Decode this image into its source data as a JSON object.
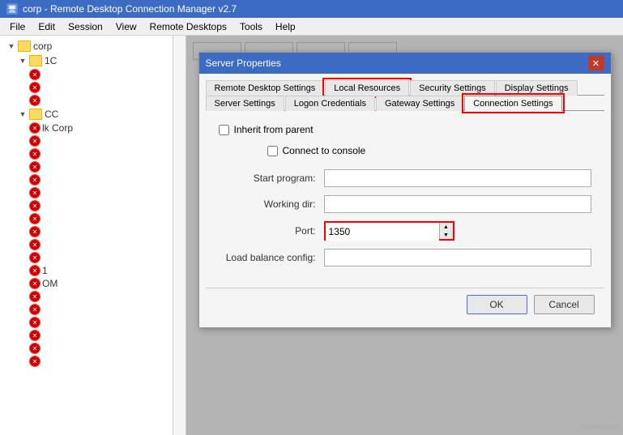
{
  "titleBar": {
    "icon": "🖥",
    "title": "corp - Remote Desktop Connection Manager v2.7"
  },
  "menuBar": {
    "items": [
      "File",
      "Edit",
      "Session",
      "View",
      "Remote Desktops",
      "Tools",
      "Help"
    ]
  },
  "tree": {
    "items": [
      {
        "label": "corp",
        "level": 0,
        "type": "root",
        "expanded": true
      },
      {
        "label": "1C",
        "level": 1,
        "type": "folder",
        "expanded": true
      },
      {
        "label": "",
        "level": 2,
        "type": "error"
      },
      {
        "label": "",
        "level": 2,
        "type": "error"
      },
      {
        "label": "",
        "level": 2,
        "type": "error"
      },
      {
        "label": "CC",
        "level": 1,
        "type": "folder",
        "expanded": true
      },
      {
        "label": "lk Corp",
        "level": 2,
        "type": "server"
      },
      {
        "label": "",
        "level": 2,
        "type": "error"
      },
      {
        "label": "",
        "level": 2,
        "type": "error"
      },
      {
        "label": "",
        "level": 2,
        "type": "error"
      },
      {
        "label": "",
        "level": 2,
        "type": "error"
      },
      {
        "label": "",
        "level": 2,
        "type": "error"
      },
      {
        "label": "",
        "level": 2,
        "type": "error"
      },
      {
        "label": "",
        "level": 2,
        "type": "error"
      },
      {
        "label": "",
        "level": 2,
        "type": "error"
      },
      {
        "label": "",
        "level": 2,
        "type": "error"
      },
      {
        "label": "",
        "level": 2,
        "type": "error"
      },
      {
        "label": "",
        "level": 2,
        "type": "error"
      },
      {
        "label": "1",
        "level": 2,
        "type": "server"
      },
      {
        "label": "OM",
        "level": 2,
        "type": "server"
      },
      {
        "label": "",
        "level": 2,
        "type": "error"
      },
      {
        "label": "",
        "level": 2,
        "type": "error"
      },
      {
        "label": "",
        "level": 2,
        "type": "error"
      },
      {
        "label": "",
        "level": 2,
        "type": "error"
      },
      {
        "label": "",
        "level": 2,
        "type": "error"
      },
      {
        "label": "",
        "level": 2,
        "type": "error"
      }
    ]
  },
  "topTabs": [
    "",
    "",
    "",
    ""
  ],
  "dialog": {
    "title": "Server Properties",
    "tabs": [
      {
        "label": "Remote Desktop Settings",
        "active": false,
        "highlighted": false
      },
      {
        "label": "Local Resources",
        "active": false,
        "highlighted": true
      },
      {
        "label": "Security Settings",
        "active": false,
        "highlighted": false
      },
      {
        "label": "Display Settings",
        "active": false,
        "highlighted": false
      },
      {
        "label": "Server Settings",
        "active": false,
        "highlighted": false
      },
      {
        "label": "Logon Credentials",
        "active": false,
        "highlighted": false
      },
      {
        "label": "Gateway Settings",
        "active": false,
        "highlighted": false
      },
      {
        "label": "Connection Settings",
        "active": true,
        "highlighted": true
      }
    ],
    "form": {
      "inheritFromParent": {
        "label": "Inherit from parent",
        "checked": false
      },
      "connectToConsole": {
        "label": "Connect to console",
        "checked": false
      },
      "fields": [
        {
          "label": "Start program:",
          "value": "",
          "id": "start-program"
        },
        {
          "label": "Working dir:",
          "value": "",
          "id": "working-dir"
        },
        {
          "label": "Port:",
          "value": "1350",
          "id": "port",
          "spinbox": true
        },
        {
          "label": "Load balance config:",
          "value": "",
          "id": "load-balance"
        }
      ]
    },
    "footer": {
      "okLabel": "OK",
      "cancelLabel": "Cancel"
    }
  },
  "watermark": "wsxdn.com"
}
